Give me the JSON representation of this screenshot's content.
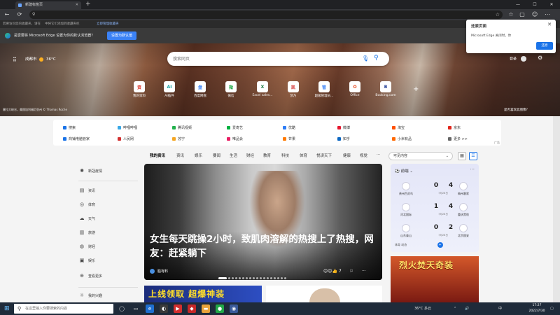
{
  "window": {
    "tab_title": "新建标签页",
    "minimize": "—",
    "maximize": "☐",
    "close": "✕"
  },
  "toolbar": {
    "address": "",
    "back": "←",
    "refresh": "⟳"
  },
  "favorites_bar": {
    "text1": "若要访问您的收藏夹，请在",
    "text2": "中将它们添加到收藏夹栏",
    "link": "立即管理收藏夹"
  },
  "infobar": {
    "message": "是否要将 Microsoft Edge 设置为你的默认浏览器?",
    "button": "设置为默认值"
  },
  "popup": {
    "title": "还原页面",
    "message": "Microsoft Edge 关闭时，你",
    "button": "还原"
  },
  "hero": {
    "location": "成都市",
    "temperature": "36°C",
    "search_placeholder": "搜索网页",
    "login": "登录",
    "credit": "塞拉大峡谷，美国加利福尼亚州 © Thomas Roche",
    "like": "是否喜欢此图像?",
    "quick_links": [
      {
        "label": "我的资料",
        "glyph": "资",
        "color": "#d93025"
      },
      {
        "label": "AI插件",
        "glyph": "AI",
        "color": "#1aa3a3"
      },
      {
        "label": "百度网盘",
        "glyph": "盘",
        "color": "#3b82f6"
      },
      {
        "label": "微信",
        "glyph": "微",
        "color": "#22a848"
      },
      {
        "label": "Excel sales...",
        "glyph": "X",
        "color": "#1d7a44"
      },
      {
        "label": "凯乃",
        "glyph": "凯",
        "color": "#d32f2f"
      },
      {
        "label": "超级管理员...",
        "glyph": "管",
        "color": "#3b82f6"
      },
      {
        "label": "Office",
        "glyph": "O",
        "color": "#e8491f"
      },
      {
        "label": "Booking.com",
        "glyph": "B",
        "color": "#1f3a93"
      }
    ]
  },
  "links": {
    "row1": [
      {
        "label": "搜索",
        "color": "#1a73e8"
      },
      {
        "label": "哔哩哔哩",
        "color": "#39a8e6"
      },
      {
        "label": "腾讯视频",
        "color": "#22b14c"
      },
      {
        "label": "爱奇艺",
        "color": "#00b140"
      },
      {
        "label": "优酷",
        "color": "#2d7df6"
      },
      {
        "label": "微博",
        "color": "#e6162d"
      },
      {
        "label": "淘宝",
        "color": "#ff5000"
      },
      {
        "label": "京东",
        "color": "#e1251b"
      }
    ],
    "row2": [
      {
        "label": "商铺电脑管家",
        "color": "#1a73e8"
      },
      {
        "label": "人民网",
        "color": "#d32f2f"
      },
      {
        "label": "苏宁",
        "color": "#f5a623"
      },
      {
        "label": "唯品会",
        "color": "#e91e63"
      },
      {
        "label": "芒果",
        "color": "#ff7a00"
      },
      {
        "label": "知乎",
        "color": "#0a66c2"
      },
      {
        "label": "小米有品",
        "color": "#ff6900"
      },
      {
        "label": "更多 >>",
        "color": "#666666"
      }
    ],
    "ad": "广告"
  },
  "news_tabs": {
    "items": [
      "我的资讯",
      "资讯",
      "娱乐",
      "要闻",
      "生活",
      "财经",
      "教育",
      "科技",
      "体育",
      "悦读天下",
      "健康",
      "视觉"
    ],
    "more": "···",
    "preference": "可见内容",
    "view_grid": "▦",
    "view_list": "☰"
  },
  "left_nav": {
    "new_card": "新冠疫情",
    "items": [
      {
        "label": "资讯",
        "glyph": "▤"
      },
      {
        "label": "体育",
        "glyph": "◎"
      },
      {
        "label": "天气",
        "glyph": "☁"
      },
      {
        "label": "旅游",
        "glyph": "▥"
      },
      {
        "label": "财经",
        "glyph": "◍"
      },
      {
        "label": "娱乐",
        "glyph": "▣"
      },
      {
        "label": "查看更多",
        "glyph": "⊕"
      }
    ],
    "bottom": "我的兴趣"
  },
  "feature": {
    "title": "女生每天跳操2小时，致肌肉溶解的热搜上了热搜，网友：赶紧躺下",
    "source": "脂有料",
    "reactions": "😊😊👍 7",
    "bookmark": "⚐",
    "more": "···"
  },
  "sports": {
    "heading": "前端",
    "more": "···",
    "matches": [
      {
        "home": "贵州百灵鸟",
        "away": "梅州客家",
        "score_home": "0",
        "score_away": "4",
        "date": "7月28日"
      },
      {
        "home": "河北国际",
        "away": "重庆黑豹",
        "score_home": "1",
        "score_away": "4",
        "date": "7月28日"
      },
      {
        "home": "山东泰山",
        "away": "北京国安",
        "score_home": "0",
        "score_away": "2",
        "date": "7月28日"
      }
    ],
    "footer": "体育 动态",
    "add": "+"
  },
  "game_ad": {
    "text": "烈火焚天奇装"
  },
  "bottom_ad": {
    "text": "上线领取 超爆神装"
  },
  "taskbar": {
    "search_placeholder": "在这里输入你要搜索的内容",
    "weather": "36°C 多云",
    "ime": "中",
    "time": "17:27",
    "date": "2022/7/30"
  }
}
